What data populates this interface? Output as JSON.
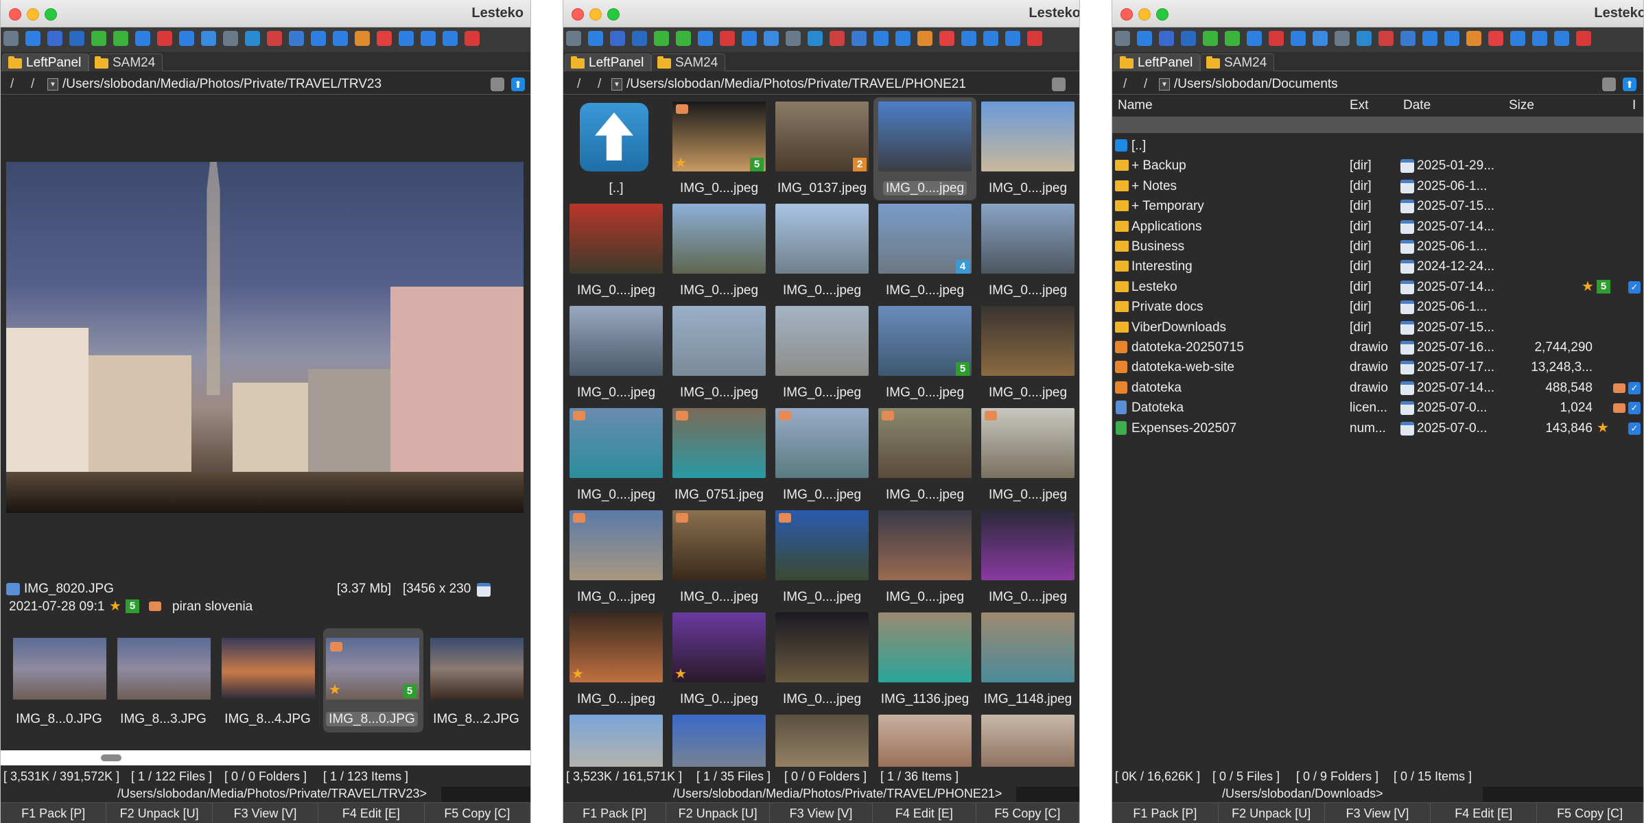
{
  "app_title": "Lesteko",
  "tabs": {
    "left": "LeftPanel",
    "right": "SAM24"
  },
  "function_keys": [
    "F1 Pack [P]",
    "F2 Unpack [U]",
    "F3 View [V]",
    "F4 Edit [E]",
    "F5 Copy [C]"
  ],
  "panel1": {
    "path": "/Users/slobodan/Media/Photos/Private/TRAVEL/TRV23",
    "file_name": "IMG_8020.JPG",
    "file_size": "[3.37 Mb]",
    "dimensions": "[3456 x 230",
    "date": "2021-07-28 09:1",
    "rating_badge": "5",
    "tags": "piran slovenia",
    "filmstrip": [
      "IMG_8...0.JPG",
      "IMG_8...3.JPG",
      "IMG_8...4.JPG",
      "IMG_8...0.JPG",
      "IMG_8...2.JPG"
    ],
    "status": {
      "size": "[ 3,531K / 391,572K ]",
      "files": "[ 1 / 122 Files ]",
      "folders": "[ 0 / 0 Folders ]",
      "items": "[ 1 / 123 Items ]"
    },
    "prompt": "/Users/slobodan/Media/Photos/Private/TRAVEL/TRV23>"
  },
  "panel2": {
    "path": "/Users/slobodan/Media/Photos/Private/TRAVEL/PHONE21",
    "thumbs": [
      {
        "label": "[..]",
        "up": true
      },
      {
        "label": "IMG_0....jpeg",
        "badge": "5",
        "star": true,
        "tag": true,
        "c1": "#1a1a1a",
        "c2": "#c89a62"
      },
      {
        "label": "IMG_0137.jpeg",
        "badge": "2",
        "c1": "#8a7a66",
        "c2": "#4a3a2a"
      },
      {
        "label": "IMG_0....jpeg",
        "selected": true,
        "c1": "#4d7fc8",
        "c2": "#3b3f44"
      },
      {
        "label": "IMG_0....jpeg",
        "c1": "#6a9ad8",
        "c2": "#c8b89c"
      },
      {
        "label": "IMG_0....jpeg",
        "c1": "#b8362a",
        "c2": "#3e3a2a"
      },
      {
        "label": "IMG_0....jpeg",
        "c1": "#8eb0d8",
        "c2": "#5e6650"
      },
      {
        "label": "IMG_0....jpeg",
        "c1": "#a8c4e4",
        "c2": "#70808c"
      },
      {
        "label": "IMG_0....jpeg",
        "badge": "4",
        "badgeColor": "#3a9ad6",
        "c1": "#7a9cc8",
        "c2": "#6c7882"
      },
      {
        "label": "IMG_0....jpeg",
        "c1": "#8aa4c4",
        "c2": "#4c5660"
      },
      {
        "label": "IMG_0....jpeg",
        "c1": "#98a8c0",
        "c2": "#4a5a6a"
      },
      {
        "label": "IMG_0....jpeg",
        "c1": "#9ab0c8",
        "c2": "#7a8a98"
      },
      {
        "label": "IMG_0....jpeg",
        "c1": "#a4b4c4",
        "c2": "#8c8c88"
      },
      {
        "label": "IMG_0....jpeg",
        "badge": "5",
        "c1": "#6a8cbc",
        "c2": "#3e5870"
      },
      {
        "label": "IMG_0....jpeg",
        "c1": "#3a3430",
        "c2": "#8a6a40"
      },
      {
        "label": "IMG_0....jpeg",
        "tag": true,
        "c1": "#6a8cb0",
        "c2": "#2a8c9c"
      },
      {
        "label": "IMG_0751.jpeg",
        "tag": true,
        "c1": "#7a6a58",
        "c2": "#2a9aa4"
      },
      {
        "label": "IMG_0....jpeg",
        "tag": true,
        "c1": "#98acc8",
        "c2": "#5a7a80"
      },
      {
        "label": "IMG_0....jpeg",
        "tag": true,
        "c1": "#8a8a70",
        "c2": "#5a4a3a"
      },
      {
        "label": "IMG_0....jpeg",
        "tag": true,
        "c1": "#c8c8c0",
        "c2": "#7a7060"
      },
      {
        "label": "IMG_0....jpeg",
        "tag": true,
        "c1": "#5a7aa8",
        "c2": "#a89880"
      },
      {
        "label": "IMG_0....jpeg",
        "tag": true,
        "c1": "#8a7050",
        "c2": "#3a2a1a"
      },
      {
        "label": "IMG_0....jpeg",
        "tag": true,
        "c1": "#2a5ab0",
        "c2": "#3a4a30"
      },
      {
        "label": "IMG_0....jpeg",
        "c1": "#3a3a48",
        "c2": "#9a6a50"
      },
      {
        "label": "IMG_0....jpeg",
        "c1": "#2a2a3a",
        "c2": "#8a3aa0"
      },
      {
        "label": "IMG_0....jpeg",
        "star": true,
        "c1": "#3a2a20",
        "c2": "#c07040"
      },
      {
        "label": "IMG_0....jpeg",
        "star": true,
        "c1": "#6a3aa0",
        "c2": "#2a1a2a"
      },
      {
        "label": "IMG_0....jpeg",
        "c1": "#1a1a22",
        "c2": "#6a5a40"
      },
      {
        "label": "IMG_1136.jpeg",
        "c1": "#9a8a70",
        "c2": "#2aa49a"
      },
      {
        "label": "IMG_1148.jpeg",
        "c1": "#a08a70",
        "c2": "#4a8a9a"
      },
      {
        "label": "",
        "c1": "#7aa4d8",
        "c2": "#c8b8a0"
      },
      {
        "label": "",
        "c1": "#3a6ac8",
        "c2": "#8a8a80"
      },
      {
        "label": "",
        "c1": "#5a5040",
        "c2": "#a89070"
      },
      {
        "label": "",
        "c1": "#c8b0a0",
        "c2": "#8a5a40"
      },
      {
        "label": "",
        "c1": "#c8b8a8",
        "c2": "#7a5a48"
      }
    ],
    "status": {
      "size": "[ 3,523K / 161,571K ]",
      "files": "[ 1 / 35 Files ]",
      "folders": "[ 0 / 0 Folders ]",
      "items": "[ 1 / 36 Items ]"
    },
    "prompt": "/Users/slobodan/Media/Photos/Private/TRAVEL/PHONE21>"
  },
  "panel3": {
    "path": "/Users/slobodan/Documents",
    "columns": {
      "name": "Name",
      "ext": "Ext",
      "date": "Date",
      "size": "Size",
      "extra": "I"
    },
    "rows": [
      {
        "icon": "up",
        "name": "[..]",
        "ext": "",
        "date": "",
        "size": ""
      },
      {
        "icon": "dir",
        "name": "+ Backup",
        "ext": "[dir]",
        "date": "2025-01-29...",
        "size": ""
      },
      {
        "icon": "dir",
        "name": "+ Notes",
        "ext": "[dir]",
        "date": "2025-06-1...",
        "size": ""
      },
      {
        "icon": "dir",
        "name": "+ Temporary",
        "ext": "[dir]",
        "date": "2025-07-15...",
        "size": ""
      },
      {
        "icon": "dir",
        "name": "Applications",
        "ext": "[dir]",
        "date": "2025-07-14...",
        "size": ""
      },
      {
        "icon": "dir",
        "name": "Business",
        "ext": "[dir]",
        "date": "2025-06-1...",
        "size": ""
      },
      {
        "icon": "dir",
        "name": "Interesting",
        "ext": "[dir]",
        "date": "2024-12-24...",
        "size": ""
      },
      {
        "icon": "dir",
        "name": "Lesteko",
        "ext": "[dir]",
        "date": "2025-07-14...",
        "size": "",
        "star": true,
        "badge": "5",
        "check": true
      },
      {
        "icon": "dir",
        "name": "Private docs",
        "ext": "[dir]",
        "date": "2025-06-1...",
        "size": ""
      },
      {
        "icon": "dir",
        "name": "ViberDownloads",
        "ext": "[dir]",
        "date": "2025-07-15...",
        "size": ""
      },
      {
        "icon": "draw",
        "name": "datoteka-20250715",
        "ext": "drawio",
        "date": "2025-07-16...",
        "size": "2,744,290"
      },
      {
        "icon": "draw",
        "name": "datoteka-web-site",
        "ext": "drawio",
        "date": "2025-07-17...",
        "size": "13,248,3..."
      },
      {
        "icon": "draw",
        "name": "datoteka",
        "ext": "drawio",
        "date": "2025-07-14...",
        "size": "488,548",
        "tag": true,
        "check": true
      },
      {
        "icon": "lic",
        "name": "Datoteka",
        "ext": "licen...",
        "date": "2025-07-0...",
        "size": "1,024",
        "tag": true,
        "check": true
      },
      {
        "icon": "num",
        "name": "Expenses-202507",
        "ext": "num...",
        "date": "2025-07-0...",
        "size": "143,846",
        "star": true,
        "check": true
      }
    ],
    "status": {
      "size": "[ 0K / 16,626K ]",
      "files": "[ 0 / 5 Files ]",
      "folders": "[ 0 / 9 Folders ]",
      "items": "[ 0 / 15 Items ]"
    },
    "prompt": "/Users/slobodan/Downloads>"
  }
}
